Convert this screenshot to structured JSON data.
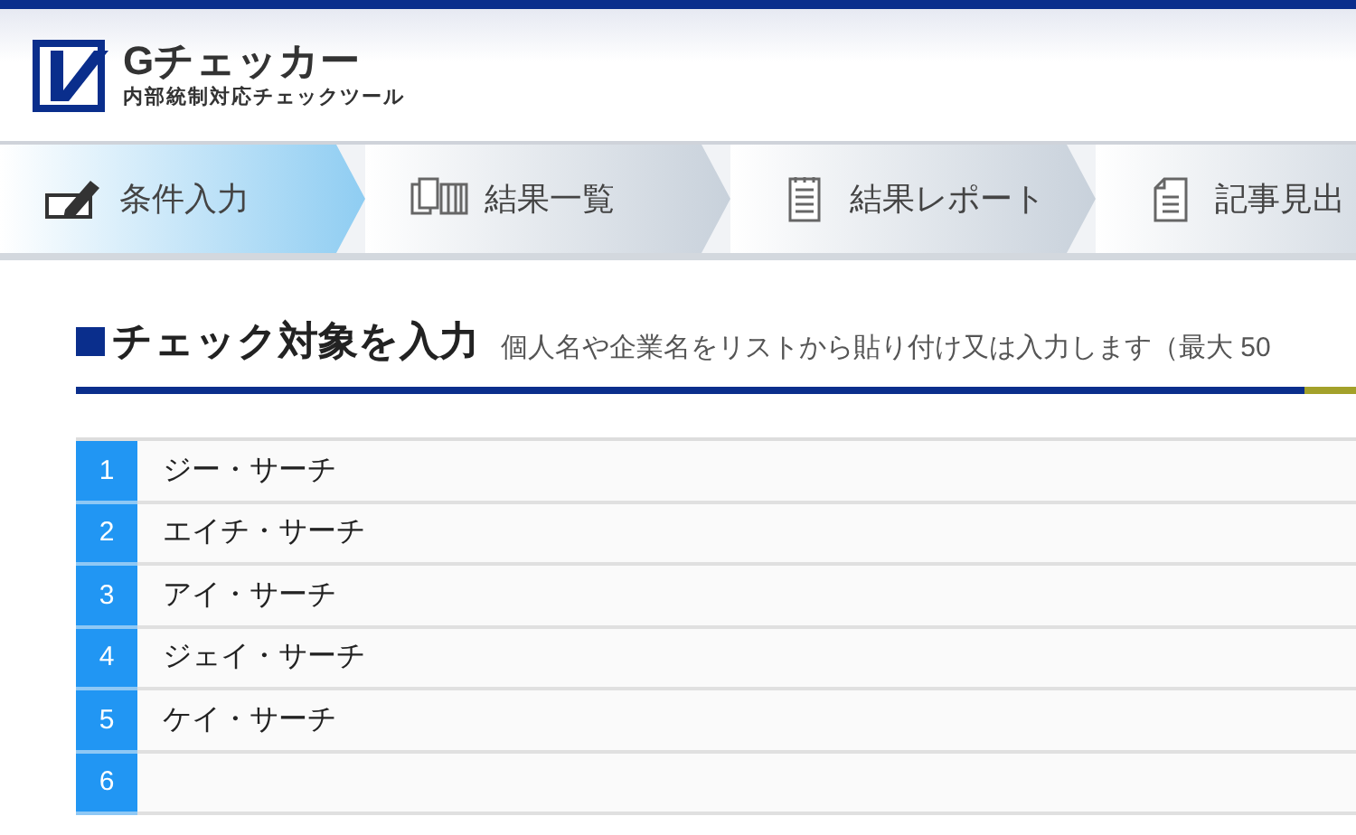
{
  "logo": {
    "title": "Gチェッカー",
    "subtitle": "内部統制対応チェックツール"
  },
  "steps": [
    {
      "label": "条件入力",
      "kind": "pencil",
      "selected": true
    },
    {
      "label": "結果一覧",
      "kind": "list",
      "selected": false
    },
    {
      "label": "結果レポート",
      "kind": "report",
      "selected": false
    },
    {
      "label": "記事見出",
      "kind": "article",
      "selected": false
    }
  ],
  "section": {
    "title": "チェック対象を入力",
    "description": "個人名や企業名をリストから貼り付け又は入力します（最大 50"
  },
  "rows": [
    {
      "number": "1",
      "value": "ジー・サーチ"
    },
    {
      "number": "2",
      "value": "エイチ・サーチ"
    },
    {
      "number": "3",
      "value": "アイ・サーチ"
    },
    {
      "number": "4",
      "value": "ジェイ・サーチ"
    },
    {
      "number": "5",
      "value": "ケイ・サーチ"
    },
    {
      "number": "6"
    }
  ]
}
